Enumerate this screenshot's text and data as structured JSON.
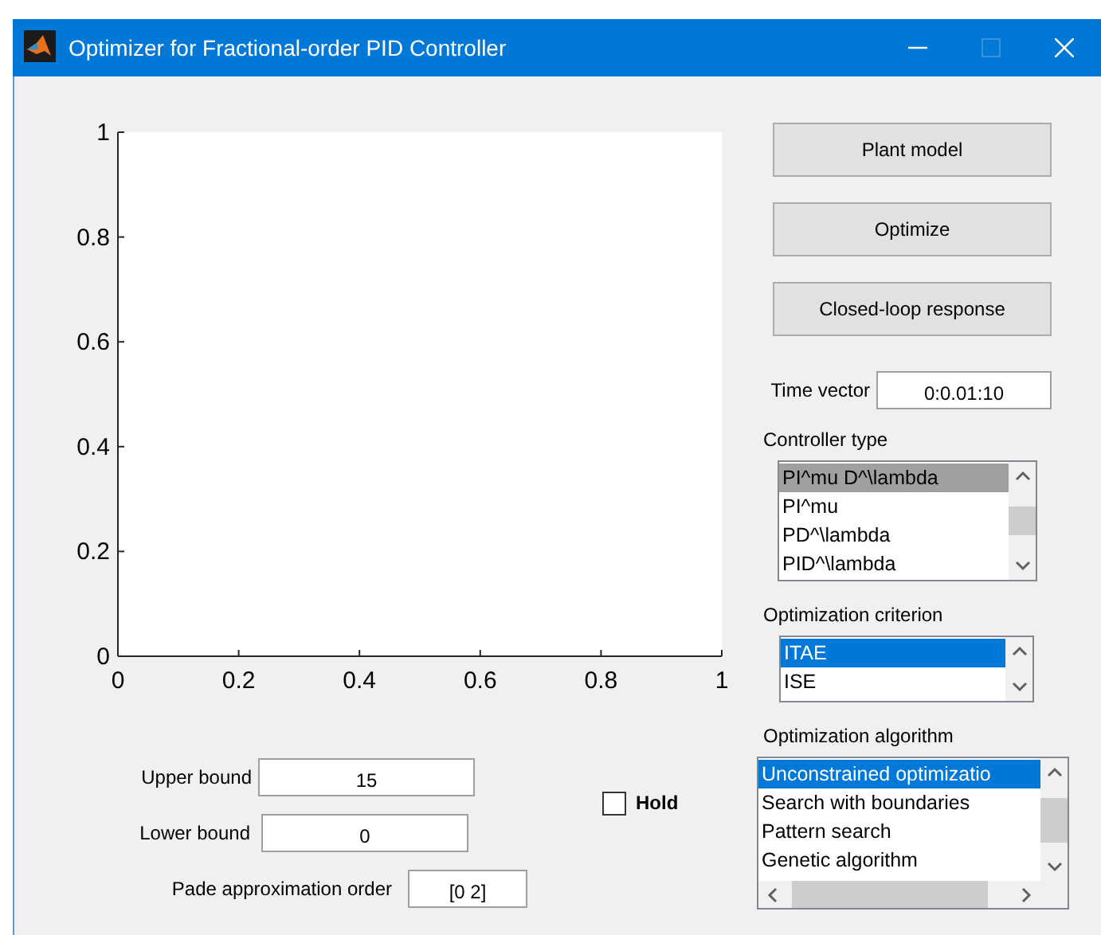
{
  "window": {
    "title": "Optimizer for Fractional-order PID Controller"
  },
  "axes": {
    "chart_data": {
      "type": "line",
      "xlim": [
        0,
        1
      ],
      "ylim": [
        0,
        1
      ],
      "xticks": [
        0,
        0.2,
        0.4,
        0.6,
        0.8,
        1
      ],
      "yticks": [
        0,
        0.2,
        0.4,
        0.6,
        0.8,
        1
      ]
    }
  },
  "buttons": [
    "Plant model",
    "Optimize",
    "Closed-loop response"
  ],
  "time_vector": {
    "label": "Time vector",
    "value": "0:0.01:10"
  },
  "controller_type": {
    "label": "Controller type",
    "focused": false,
    "items": [
      {
        "text": "PI^mu D^\\lambda",
        "selected": true
      },
      {
        "text": "PI^mu",
        "selected": false
      },
      {
        "text": "PD^\\lambda",
        "selected": false
      },
      {
        "text": "PID^\\lambda",
        "selected": false
      }
    ]
  },
  "optimization_criterion": {
    "label": "Optimization criterion",
    "focused": true,
    "items": [
      {
        "text": "ITAE",
        "selected": true
      },
      {
        "text": "ISE",
        "selected": false
      }
    ]
  },
  "optimization_algorithm": {
    "label": "Optimization algorithm",
    "focused": true,
    "items": [
      {
        "text": "Unconstrained optimizatio",
        "selected": true
      },
      {
        "text": "Search with boundaries",
        "selected": false
      },
      {
        "text": "Pattern search",
        "selected": false
      },
      {
        "text": "Genetic algorithm",
        "selected": false
      }
    ]
  },
  "upper_bound": {
    "label": "Upper bound",
    "value": "15"
  },
  "lower_bound": {
    "label": "Lower bound",
    "value": "0"
  },
  "pade_order": {
    "label": "Pade approximation order",
    "value": "[0 2]"
  },
  "hold": {
    "label": "Hold",
    "checked": false
  }
}
